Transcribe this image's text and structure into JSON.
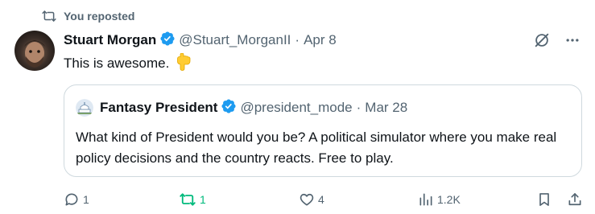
{
  "repost_banner": {
    "text": "You reposted",
    "icon": "repost-icon"
  },
  "tweet": {
    "author_name": "Stuart Morgan",
    "verified": true,
    "handle": "@Stuart_MorganII",
    "separator": "·",
    "date": "Apr 8",
    "text": "This is awesome.",
    "emoji": "👇",
    "top_actions": [
      "grok-icon",
      "more-icon"
    ]
  },
  "quoted_tweet": {
    "author_name": "Fantasy President",
    "verified": true,
    "handle": "@president_mode",
    "separator": "·",
    "date": "Mar 28",
    "text": "What kind of President would you be? A political simulator where you make real policy decisions and the country reacts. Free to play."
  },
  "actions": {
    "replies": "1",
    "reposts": "1",
    "likes": "4",
    "views": "1.2K",
    "reposted_color": "#00ba7c",
    "muted_color": "#536471",
    "verified_color": "#1d9bf0"
  }
}
